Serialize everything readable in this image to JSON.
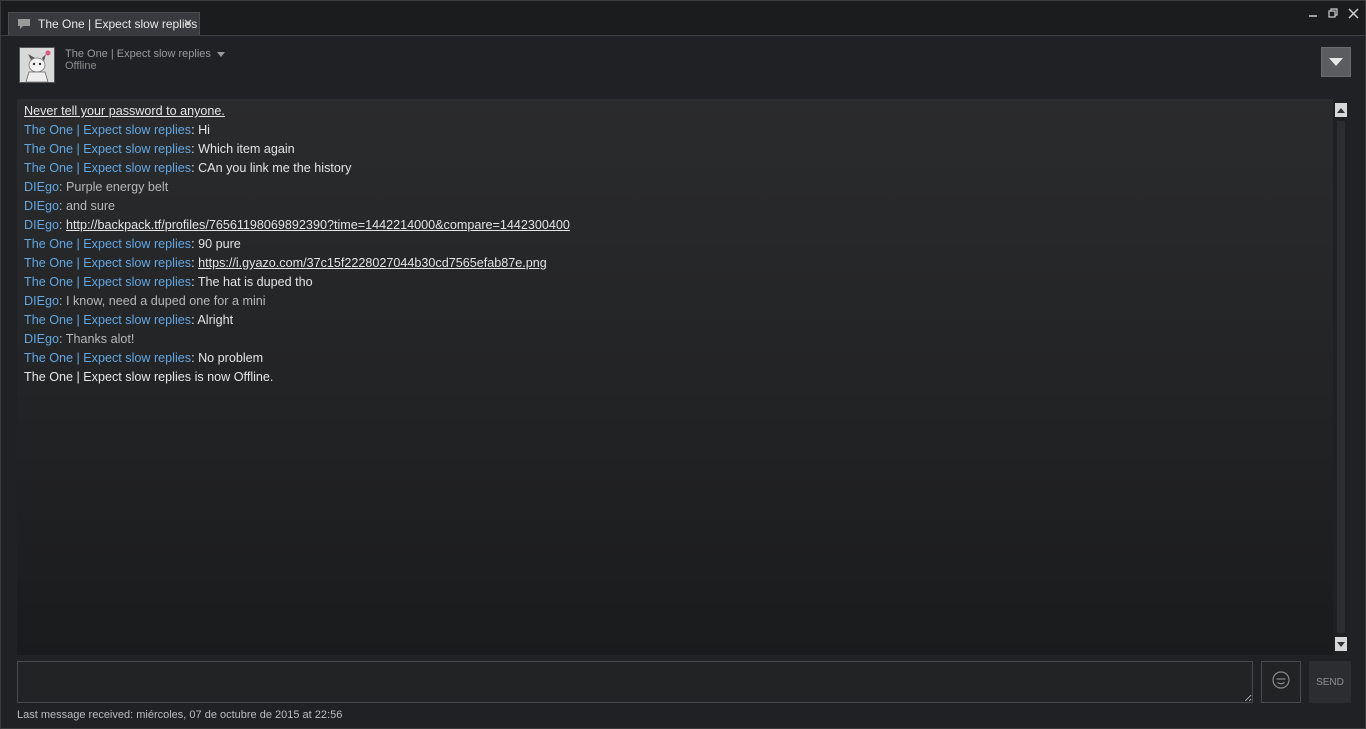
{
  "tab": {
    "label": "The One | Expect slow replies",
    "icon": "chat-bubble-icon"
  },
  "window_controls": {
    "minimize_icon": "minimize-icon",
    "restore_icon": "restore-icon",
    "close_icon": "close-icon"
  },
  "friend": {
    "name": "The One | Expect slow replies",
    "status": "Offline"
  },
  "chat": {
    "warning": "Never tell your password to anyone.",
    "messages": [
      {
        "sender": "The One | Expect slow replies",
        "from": "them",
        "text": "Hi"
      },
      {
        "sender": "The One | Expect slow replies",
        "from": "them",
        "text": "Which item again"
      },
      {
        "sender": "The One | Expect slow replies",
        "from": "them",
        "text": "CAn you link me the history"
      },
      {
        "sender": "DIEgo",
        "from": "me",
        "text": "Purple energy belt"
      },
      {
        "sender": "DIEgo",
        "from": "me",
        "text": "and sure"
      },
      {
        "sender": "DIEgo",
        "from": "me",
        "link": "http://backpack.tf/profiles/76561198069892390?time=1442214000&compare=1442300400"
      },
      {
        "sender": "The One | Expect slow replies",
        "from": "them",
        "text": "90 pure"
      },
      {
        "sender": "The One | Expect slow replies",
        "from": "them",
        "link": "https://i.gyazo.com/37c15f2228027044b30cd7565efab87e.png"
      },
      {
        "sender": "The One | Expect slow replies",
        "from": "them",
        "text": "The hat is duped tho"
      },
      {
        "sender": "DIEgo",
        "from": "me",
        "text": "I know, need a duped one for a mini"
      },
      {
        "sender": "The One | Expect slow replies",
        "from": "them",
        "text": "Alright"
      },
      {
        "sender": "DIEgo",
        "from": "me",
        "text": "Thanks alot!"
      },
      {
        "sender": "The One | Expect slow replies",
        "from": "them",
        "text": "No problem"
      }
    ],
    "system_notice": "The One | Expect slow replies is now Offline."
  },
  "input": {
    "value": "",
    "placeholder": ""
  },
  "send_label": "SEND",
  "footer": {
    "last_message": "Last message received: miércoles, 07 de octubre de 2015 at 22:56"
  },
  "colors": {
    "sender_name": "#62a7e3",
    "background": "#202124"
  }
}
